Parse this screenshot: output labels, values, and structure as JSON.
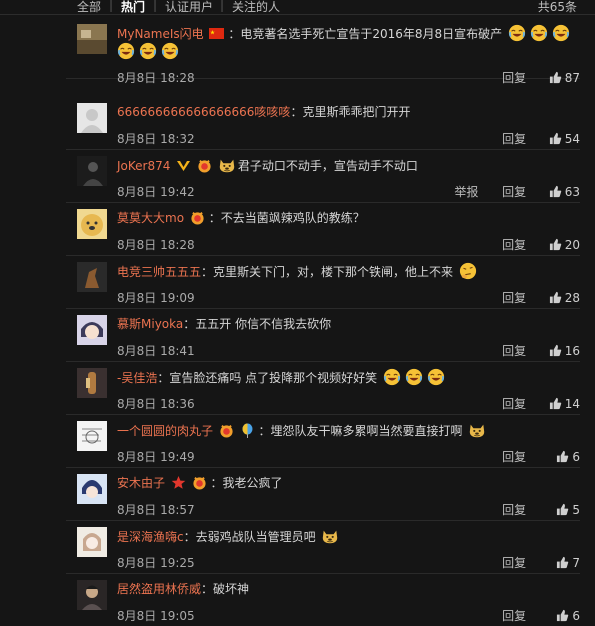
{
  "tabs": [
    {
      "label": "全部",
      "active": false
    },
    {
      "label": "热门",
      "active": true
    },
    {
      "label": "认证用户",
      "active": false
    },
    {
      "label": "关注的人",
      "active": false
    }
  ],
  "total": "共65条",
  "actions": {
    "reply": "回复",
    "report": "举报"
  },
  "comments": [
    {
      "user": "MyNameIs闪电",
      "badges": [
        "flag-cn-icon"
      ],
      "text": "电竞著名选手死亡宣告于2016年8月8日宣布破产",
      "emojis_inline": [
        "laugh-cry-emoji",
        "laugh-cry-emoji",
        "laugh-cry-emoji"
      ],
      "emojis_line2": [
        "laugh-cry-emoji",
        "laugh-cry-emoji",
        "laugh-cry-emoji"
      ],
      "time": "8月8日 18:28",
      "likes": "87",
      "avatar": "landscape-avatar"
    },
    {
      "user": "666666666666666666咳咳咳",
      "badges": [],
      "text": "克里斯乖乖把门开开",
      "time": "8月8日 18:32",
      "likes": "54",
      "avatar": "default-avatar"
    },
    {
      "user": "JoKer874",
      "badges": [
        "vip-v-icon",
        "fan-badge-icon"
      ],
      "text": "君子动口不动手，宣告动手不动口",
      "emojis_inline": [
        "doge-emoji"
      ],
      "time": "8月8日 19:42",
      "likes": "63",
      "report": true,
      "avatar": "dark-avatar"
    },
    {
      "user": "莫莫大大mo",
      "badges": [
        "fan-badge-icon"
      ],
      "text": "不去当菌飒辣鸡队的教练？",
      "time": "8月8日 18:28",
      "likes": "20",
      "avatar": "doge-avatar"
    },
    {
      "user": "电竞三帅五五五",
      "badges": [],
      "text": "克里斯关下门，对，楼下那个铁闸，他上不来",
      "emojis_end": [
        "thinking-emoji"
      ],
      "time": "8月8日 19:09",
      "likes": "28",
      "avatar": "horse-avatar"
    },
    {
      "user": "慕斯Miyoka",
      "badges": [],
      "text": "五五开 你信不信我去砍你",
      "time": "8月8日 18:41",
      "likes": "16",
      "avatar": "anime-avatar"
    },
    {
      "user": "-吴佳浩",
      "badges": [],
      "text": "宣告脸还痛吗 点了投降那个视频好好笑",
      "emojis_inline": [
        "laugh-cry-emoji",
        "laugh-cry-emoji",
        "laugh-cry-emoji"
      ],
      "time": "8月8日 18:36",
      "likes": "14",
      "avatar": "bottle-avatar"
    },
    {
      "user": "一个圆圆的肉丸子",
      "badges": [
        "fan-badge-icon",
        "balloon-icon"
      ],
      "text": "埋怨队友干嘛多累啊当然要直接打啊",
      "emojis_inline": [
        "doge-emoji"
      ],
      "time": "8月8日 19:49",
      "likes": "6",
      "avatar": "sketch-avatar"
    },
    {
      "user": "安木由子",
      "badges": [
        "star-icon",
        "fan-badge-icon"
      ],
      "text": "我老公疯了",
      "time": "8月8日 18:57",
      "likes": "5",
      "avatar": "blue-anime-avatar"
    },
    {
      "user": "是深海渔嗨c",
      "badges": [],
      "text": "去弱鸡战队当管理员吧",
      "emojis_inline": [
        "doge-emoji"
      ],
      "time": "8月8日 19:25",
      "likes": "7",
      "avatar": "pale-avatar"
    },
    {
      "user": "居然盗用林侨威",
      "badges": [],
      "text": "破坏神",
      "time": "8月8日 19:05",
      "likes": "6",
      "avatar": "boy-avatar"
    }
  ],
  "colors": {
    "username": "#eb7350",
    "background": "#151515"
  }
}
